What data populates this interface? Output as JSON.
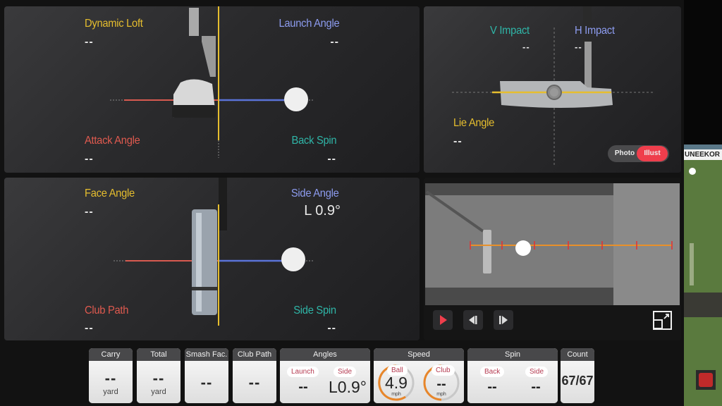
{
  "panels": {
    "side_view": {
      "dynamic_loft": {
        "label": "Dynamic Loft",
        "value": "--"
      },
      "launch_angle": {
        "label": "Launch Angle",
        "value": "--"
      },
      "attack_angle": {
        "label": "Attack Angle",
        "value": "--"
      },
      "back_spin": {
        "label": "Back Spin",
        "value": "--"
      }
    },
    "top_view": {
      "face_angle": {
        "label": "Face Angle",
        "value": "--"
      },
      "side_angle": {
        "label": "Side Angle",
        "value": "L 0.9°"
      },
      "club_path": {
        "label": "Club Path",
        "value": "--"
      },
      "side_spin": {
        "label": "Side Spin",
        "value": "--"
      }
    },
    "face_view": {
      "v_impact": {
        "label": "V Impact",
        "value": "--"
      },
      "h_impact": {
        "label": "H Impact",
        "value": "--"
      },
      "lie_angle": {
        "label": "Lie Angle",
        "value": "--"
      },
      "toggle": {
        "options": [
          "Photo",
          "Illust"
        ],
        "selected": "Illust"
      }
    },
    "camera": {
      "controls": [
        "play",
        "step-back",
        "step-forward",
        "expand"
      ]
    }
  },
  "stats": {
    "carry": {
      "header": "Carry",
      "value": "--",
      "unit": "yard"
    },
    "total": {
      "header": "Total",
      "value": "--",
      "unit": "yard"
    },
    "smash": {
      "header": "Smash Fac.",
      "value": "--"
    },
    "club_path": {
      "header": "Club Path",
      "value": "--"
    },
    "angles": {
      "header": "Angles",
      "launch_label": "Launch",
      "launch_value": "--",
      "side_label": "Side",
      "side_value": "L0.9°"
    },
    "speed": {
      "header": "Speed",
      "ball_label": "Ball",
      "ball_value": "4.9",
      "ball_unit": "mph",
      "club_label": "Club",
      "club_value": "--",
      "club_unit": "mph"
    },
    "spin": {
      "header": "Spin",
      "back_label": "Back",
      "back_value": "--",
      "side_label": "Side",
      "side_value": "--"
    },
    "count": {
      "header": "Count",
      "value": "67/67"
    }
  },
  "side_window": {
    "brand_text": "UNEEKOR"
  },
  "colors": {
    "accent_red": "#ef3e4c",
    "yellow": "#e6be2e",
    "blue": "#8d9cf0",
    "red": "#e05a4f",
    "teal": "#2fb6a8"
  }
}
